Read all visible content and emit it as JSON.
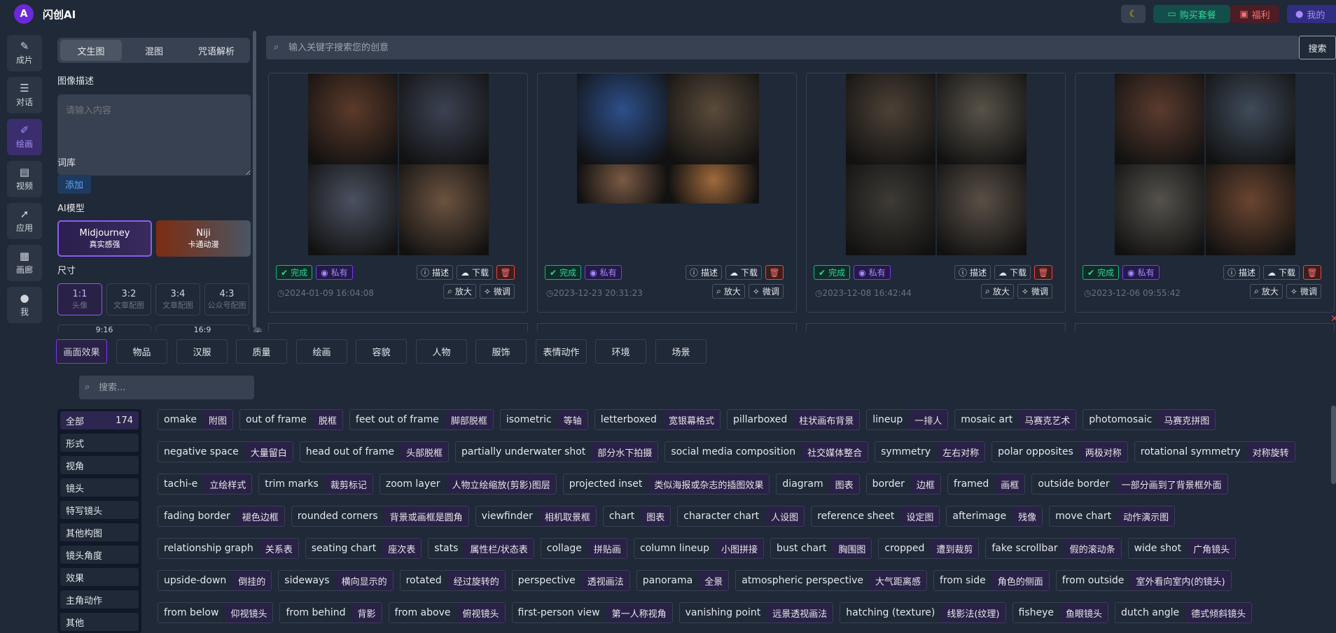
{
  "app": {
    "brand": "闪创AI",
    "logo_text": "A"
  },
  "topbar": {
    "moon_icon": "☾",
    "buy_label": "购买套餐",
    "gift_label": "福利",
    "me_label": "我的"
  },
  "nav": [
    {
      "icon": "edit-icon",
      "glyph": "✎",
      "label": "成片"
    },
    {
      "icon": "chat-icon",
      "glyph": "☰",
      "label": "对话"
    },
    {
      "icon": "draw-icon",
      "glyph": "✐",
      "label": "绘画"
    },
    {
      "icon": "video-icon",
      "glyph": "▤",
      "label": "视频"
    },
    {
      "icon": "rocket-icon",
      "glyph": "➚",
      "label": "应用"
    },
    {
      "icon": "gallery-icon",
      "glyph": "▦",
      "label": "画廊"
    },
    {
      "icon": "user-icon",
      "glyph": "●",
      "label": "我"
    }
  ],
  "panel": {
    "tabs": [
      "文生图",
      "混图",
      "咒语解析"
    ],
    "image_desc_label": "图像描述",
    "image_desc_placeholder": "请输入内容",
    "lexicon_label": "词库",
    "add_label": "添加",
    "model_label": "AI模型",
    "models": [
      {
        "name": "Midjourney",
        "sub": "真实感强"
      },
      {
        "name": "Niji",
        "sub": "卡通动漫"
      }
    ],
    "size_label": "尺寸",
    "sizes": [
      {
        "ratio": "1:1",
        "sub": "头像"
      },
      {
        "ratio": "3:2",
        "sub": "文章配图"
      },
      {
        "ratio": "3:4",
        "sub": "文章配图"
      },
      {
        "ratio": "4:3",
        "sub": "公众号配图"
      }
    ],
    "sizes_row2": [
      "9:16",
      "16:9"
    ]
  },
  "search": {
    "placeholder": "输入关键字搜索您的创意",
    "button": "搜索"
  },
  "cards": [
    {
      "status": "完成",
      "privacy": "私有",
      "time": "2024-01-09 16:04:08"
    },
    {
      "status": "完成",
      "privacy": "私有",
      "time": "2023-12-23 20:31:23"
    },
    {
      "status": "完成",
      "privacy": "私有",
      "time": "2023-12-08 16:42:44"
    },
    {
      "status": "完成",
      "privacy": "私有",
      "time": "2023-12-06 09:55:42"
    }
  ],
  "card_actions": {
    "describe": "描述",
    "download": "下载",
    "zoom": "放大",
    "tweak": "微调"
  },
  "library": {
    "categories": [
      "画面效果",
      "物品",
      "汉服",
      "质量",
      "绘画",
      "容貌",
      "人物",
      "服饰",
      "表情动作",
      "环境",
      "场景"
    ],
    "search_placeholder": "搜索...",
    "subcats": [
      "全部",
      "形式",
      "视角",
      "镜头",
      "特写镜头",
      "其他构图",
      "镜头角度",
      "效果",
      "主角动作",
      "其他"
    ],
    "all_count": "174",
    "chips": [
      [
        [
          "omake",
          "附图"
        ],
        [
          "out of frame",
          "脱框"
        ],
        [
          "feet out of frame",
          "脚部脱框"
        ],
        [
          "isometric",
          "等轴"
        ],
        [
          "letterboxed",
          "宽银幕格式"
        ],
        [
          "pillarboxed",
          "柱状画布背景"
        ],
        [
          "lineup",
          "一排人"
        ],
        [
          "mosaic art",
          "马赛克艺术"
        ],
        [
          "photomosaic",
          "马赛克拼图"
        ]
      ],
      [
        [
          "negative space",
          "大量留白"
        ],
        [
          "head out of frame",
          "头部脱框"
        ],
        [
          "partially underwater shot",
          "部分水下拍摄"
        ],
        [
          "social media composition",
          "社交媒体整合"
        ],
        [
          "symmetry",
          "左右对称"
        ],
        [
          "polar opposites",
          "两极对称"
        ],
        [
          "rotational symmetry",
          "对称旋转"
        ]
      ],
      [
        [
          "tachi-e",
          "立绘样式"
        ],
        [
          "trim marks",
          "裁剪标记"
        ],
        [
          "zoom layer",
          "人物立绘缩放(剪影)图层"
        ],
        [
          "projected inset",
          "类似海报或杂志的插图效果"
        ],
        [
          "diagram",
          "图表"
        ],
        [
          "border",
          "边框"
        ],
        [
          "framed",
          "画框"
        ],
        [
          "outside border",
          "一部分画到了背景框外面"
        ]
      ],
      [
        [
          "fading border",
          "褪色边框"
        ],
        [
          "rounded corners",
          "背景或画框是圆角"
        ],
        [
          "viewfinder",
          "相机取景框"
        ],
        [
          "chart",
          "图表"
        ],
        [
          "character chart",
          "人设图"
        ],
        [
          "reference sheet",
          "设定图"
        ],
        [
          "afterimage",
          "残像"
        ],
        [
          "move chart",
          "动作演示图"
        ]
      ],
      [
        [
          "relationship graph",
          "关系表"
        ],
        [
          "seating chart",
          "座次表"
        ],
        [
          "stats",
          "属性栏/状态表"
        ],
        [
          "collage",
          "拼贴画"
        ],
        [
          "column lineup",
          "小图拼接"
        ],
        [
          "bust chart",
          "胸围图"
        ],
        [
          "cropped",
          "遭到裁剪"
        ],
        [
          "fake scrollbar",
          "假的滚动条"
        ],
        [
          "wide shot",
          "广角镜头"
        ]
      ],
      [
        [
          "upside-down",
          "倒挂的"
        ],
        [
          "sideways",
          "横向显示的"
        ],
        [
          "rotated",
          "经过旋转的"
        ],
        [
          "perspective",
          "透视画法"
        ],
        [
          "panorama",
          "全景"
        ],
        [
          "atmospheric perspective",
          "大气距离感"
        ],
        [
          "from side",
          "角色的侧面"
        ],
        [
          "from outside",
          "室外看向室内(的镜头)"
        ]
      ],
      [
        [
          "from below",
          "仰视镜头"
        ],
        [
          "from behind",
          "背影"
        ],
        [
          "from above",
          "俯视镜头"
        ],
        [
          "first-person view",
          "第一人称视角"
        ],
        [
          "vanishing point",
          "远景透视画法"
        ],
        [
          "hatching (texture)",
          "线影法(纹理)"
        ],
        [
          "fisheye",
          "鱼眼镜头"
        ],
        [
          "dutch angle",
          "德式倾斜镜头"
        ]
      ]
    ]
  }
}
